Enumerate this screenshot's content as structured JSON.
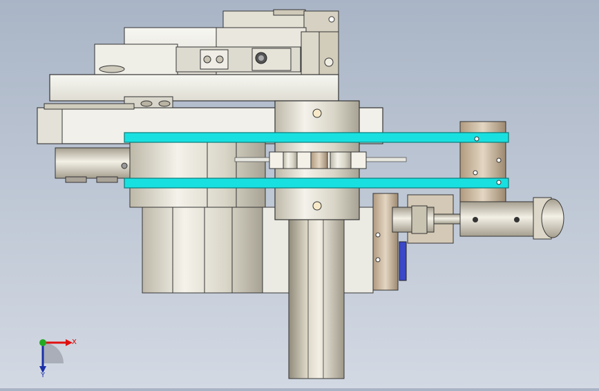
{
  "viewport": {
    "background_top": "#a9b5c6",
    "background_bottom": "#d3d9e3"
  },
  "triad": {
    "x_label": "X",
    "y_label": "Y",
    "x_color": "#e01010",
    "y_color": "#1a2fa8",
    "origin_color": "#22aa22"
  },
  "colors": {
    "belt": "#19e0e0",
    "metal_light": "#e8e8de",
    "metal_mid": "#bdbdb2",
    "bronze": "#c8b9a2",
    "cylinder_blue": "#3b48c8"
  }
}
